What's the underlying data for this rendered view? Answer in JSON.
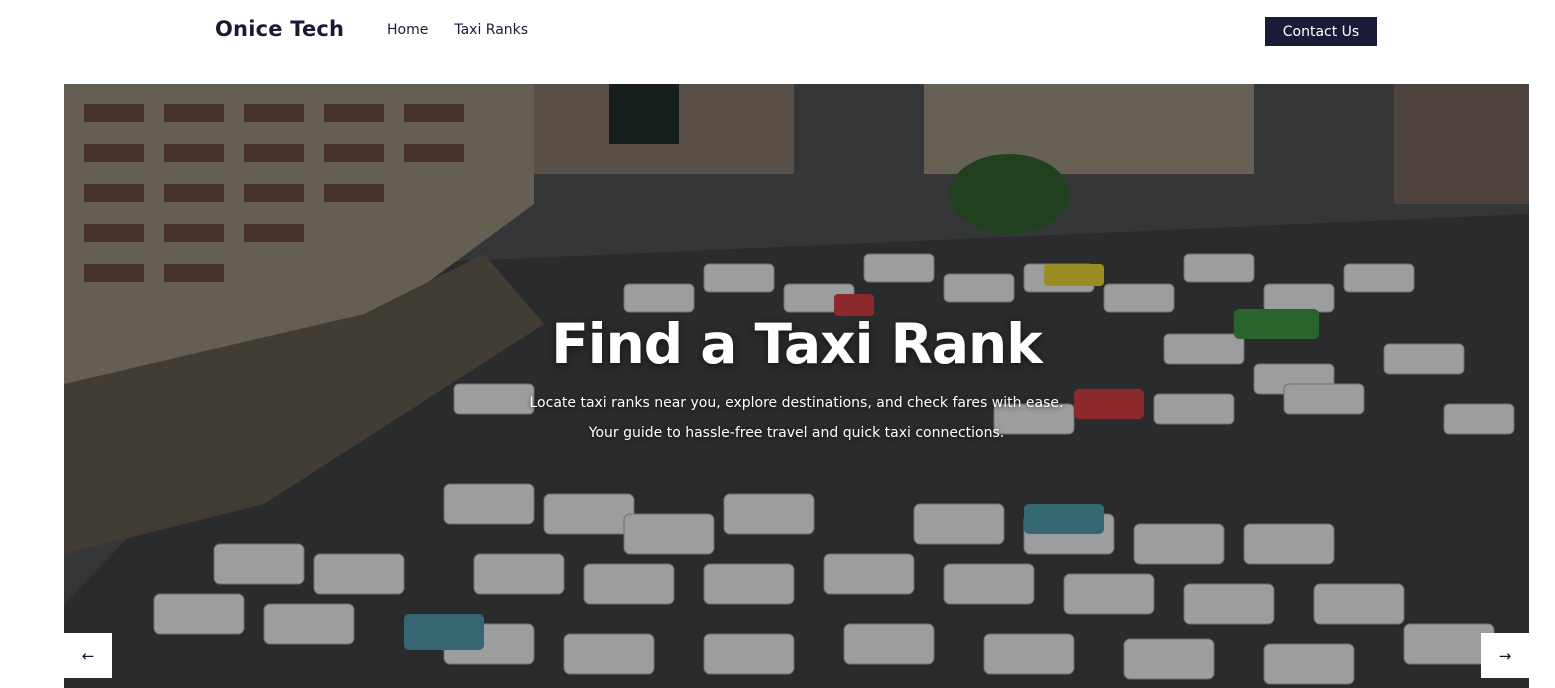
{
  "header": {
    "brand": "Onice Tech",
    "nav": [
      {
        "label": "Home"
      },
      {
        "label": "Taxi Ranks"
      }
    ],
    "contact_label": "Contact Us"
  },
  "hero": {
    "title": "Find a Taxi Rank",
    "subtitle_line1": "Locate taxi ranks near you, explore destinations, and check fares with ease.",
    "subtitle_line2": "Your guide to hassle-free travel and quick taxi connections.",
    "background_image": "aerial view of a crowded taxi rank with white minibus taxis",
    "prev_icon": "←",
    "next_icon": "→"
  },
  "colors": {
    "brand_dark": "#1b1a38",
    "text_white": "#ffffff"
  }
}
